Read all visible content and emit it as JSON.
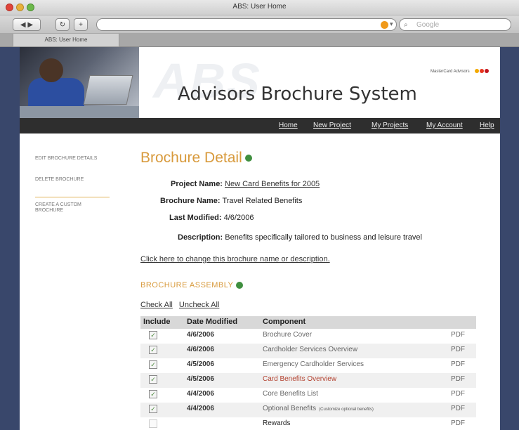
{
  "window": {
    "title": "ABS: User Home"
  },
  "browser": {
    "back_label": "◀ ▶",
    "reload_label": "↻",
    "add_label": "+",
    "search_placeholder": "Google",
    "tab_label": "ABS: User Home"
  },
  "header": {
    "watermark": "ABS",
    "app_title": "Advisors Brochure System",
    "brand": "MasterCard Advisors"
  },
  "nav": {
    "items": [
      "Home",
      "New Project",
      "My Projects",
      "My Account",
      "Help"
    ]
  },
  "sidebar": {
    "items": [
      "EDIT BROCHURE DETAILS",
      "DELETE BROCHURE",
      "CREATE A CUSTOM BROCHURE"
    ]
  },
  "page": {
    "title": "Brochure Detail",
    "project_label": "Project Name:",
    "project_value": "New Card Benefits for 2005",
    "brochure_label": "Brochure Name:",
    "brochure_value": "Travel Related Benefits",
    "modified_label": "Last Modified:",
    "modified_value": "4/6/2006",
    "description_label": "Description:",
    "description_value": "Benefits specifically tailored to business and leisure travel",
    "change_link": "Click here to change this brochure name or description.",
    "section_title": "BROCHURE ASSEMBLY",
    "check_all": "Check All",
    "uncheck_all": "Uncheck All"
  },
  "table": {
    "headers": [
      "Include",
      "Date Modified",
      "Component"
    ],
    "rows": [
      {
        "checked": true,
        "date": "4/6/2006",
        "component": "Brochure Cover",
        "note": "",
        "pdf": "PDF",
        "style": "normal"
      },
      {
        "checked": true,
        "date": "4/6/2006",
        "component": "Cardholder Services Overview",
        "note": "",
        "pdf": "PDF",
        "style": "normal"
      },
      {
        "checked": true,
        "date": "4/5/2006",
        "component": "Emergency Cardholder Services",
        "note": "",
        "pdf": "PDF",
        "style": "normal"
      },
      {
        "checked": true,
        "date": "4/5/2006",
        "component": "Card Benefits Overview",
        "note": "",
        "pdf": "PDF",
        "style": "highlight"
      },
      {
        "checked": true,
        "date": "4/4/2006",
        "component": "Core Benefits List",
        "note": "",
        "pdf": "PDF",
        "style": "normal"
      },
      {
        "checked": true,
        "date": "4/4/2006",
        "component": "Optional Benefits",
        "note": "(Customize optional benefits)",
        "pdf": "PDF",
        "style": "normal"
      },
      {
        "checked": false,
        "date": "",
        "component": "Rewards",
        "note": "",
        "pdf": "PDF",
        "style": "bold"
      }
    ]
  }
}
